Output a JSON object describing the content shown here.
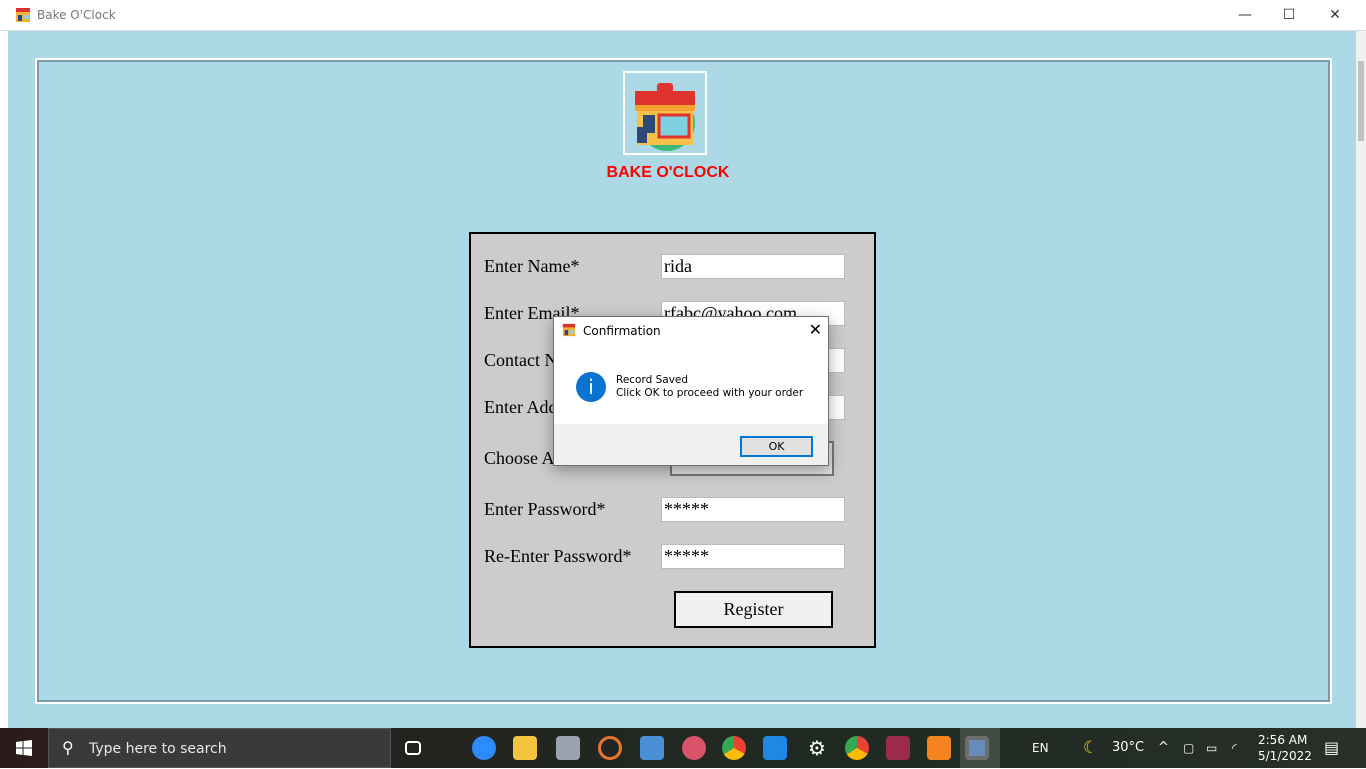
{
  "window": {
    "title": "Bake O'Clock",
    "minimize": "—",
    "maximize": "☐",
    "close": "✕"
  },
  "brand": {
    "name": "BAKE O'CLOCK"
  },
  "form": {
    "fields": [
      {
        "label": "Enter Name*",
        "value": "rida"
      },
      {
        "label": "Enter Email*",
        "value": "rfabc@yahoo.com"
      },
      {
        "label": "Contact No*",
        "value": ""
      },
      {
        "label": "Enter Address*",
        "value": ""
      },
      {
        "label": "Enter Password*",
        "value": "*****"
      },
      {
        "label": "Re-Enter Password*",
        "value": "*****"
      }
    ],
    "choose_label": "Choose A",
    "register": "Register"
  },
  "dialog": {
    "title": "Confirmation",
    "line1": "Record Saved",
    "line2": "Click OK to proceed with your order",
    "ok": "OK",
    "close": "✕",
    "info_glyph": "i"
  },
  "taskbar": {
    "search_placeholder": "Type here to search",
    "lang": "EN",
    "weather": "30°C",
    "time": "2:56 AM",
    "date": "5/1/2022"
  }
}
